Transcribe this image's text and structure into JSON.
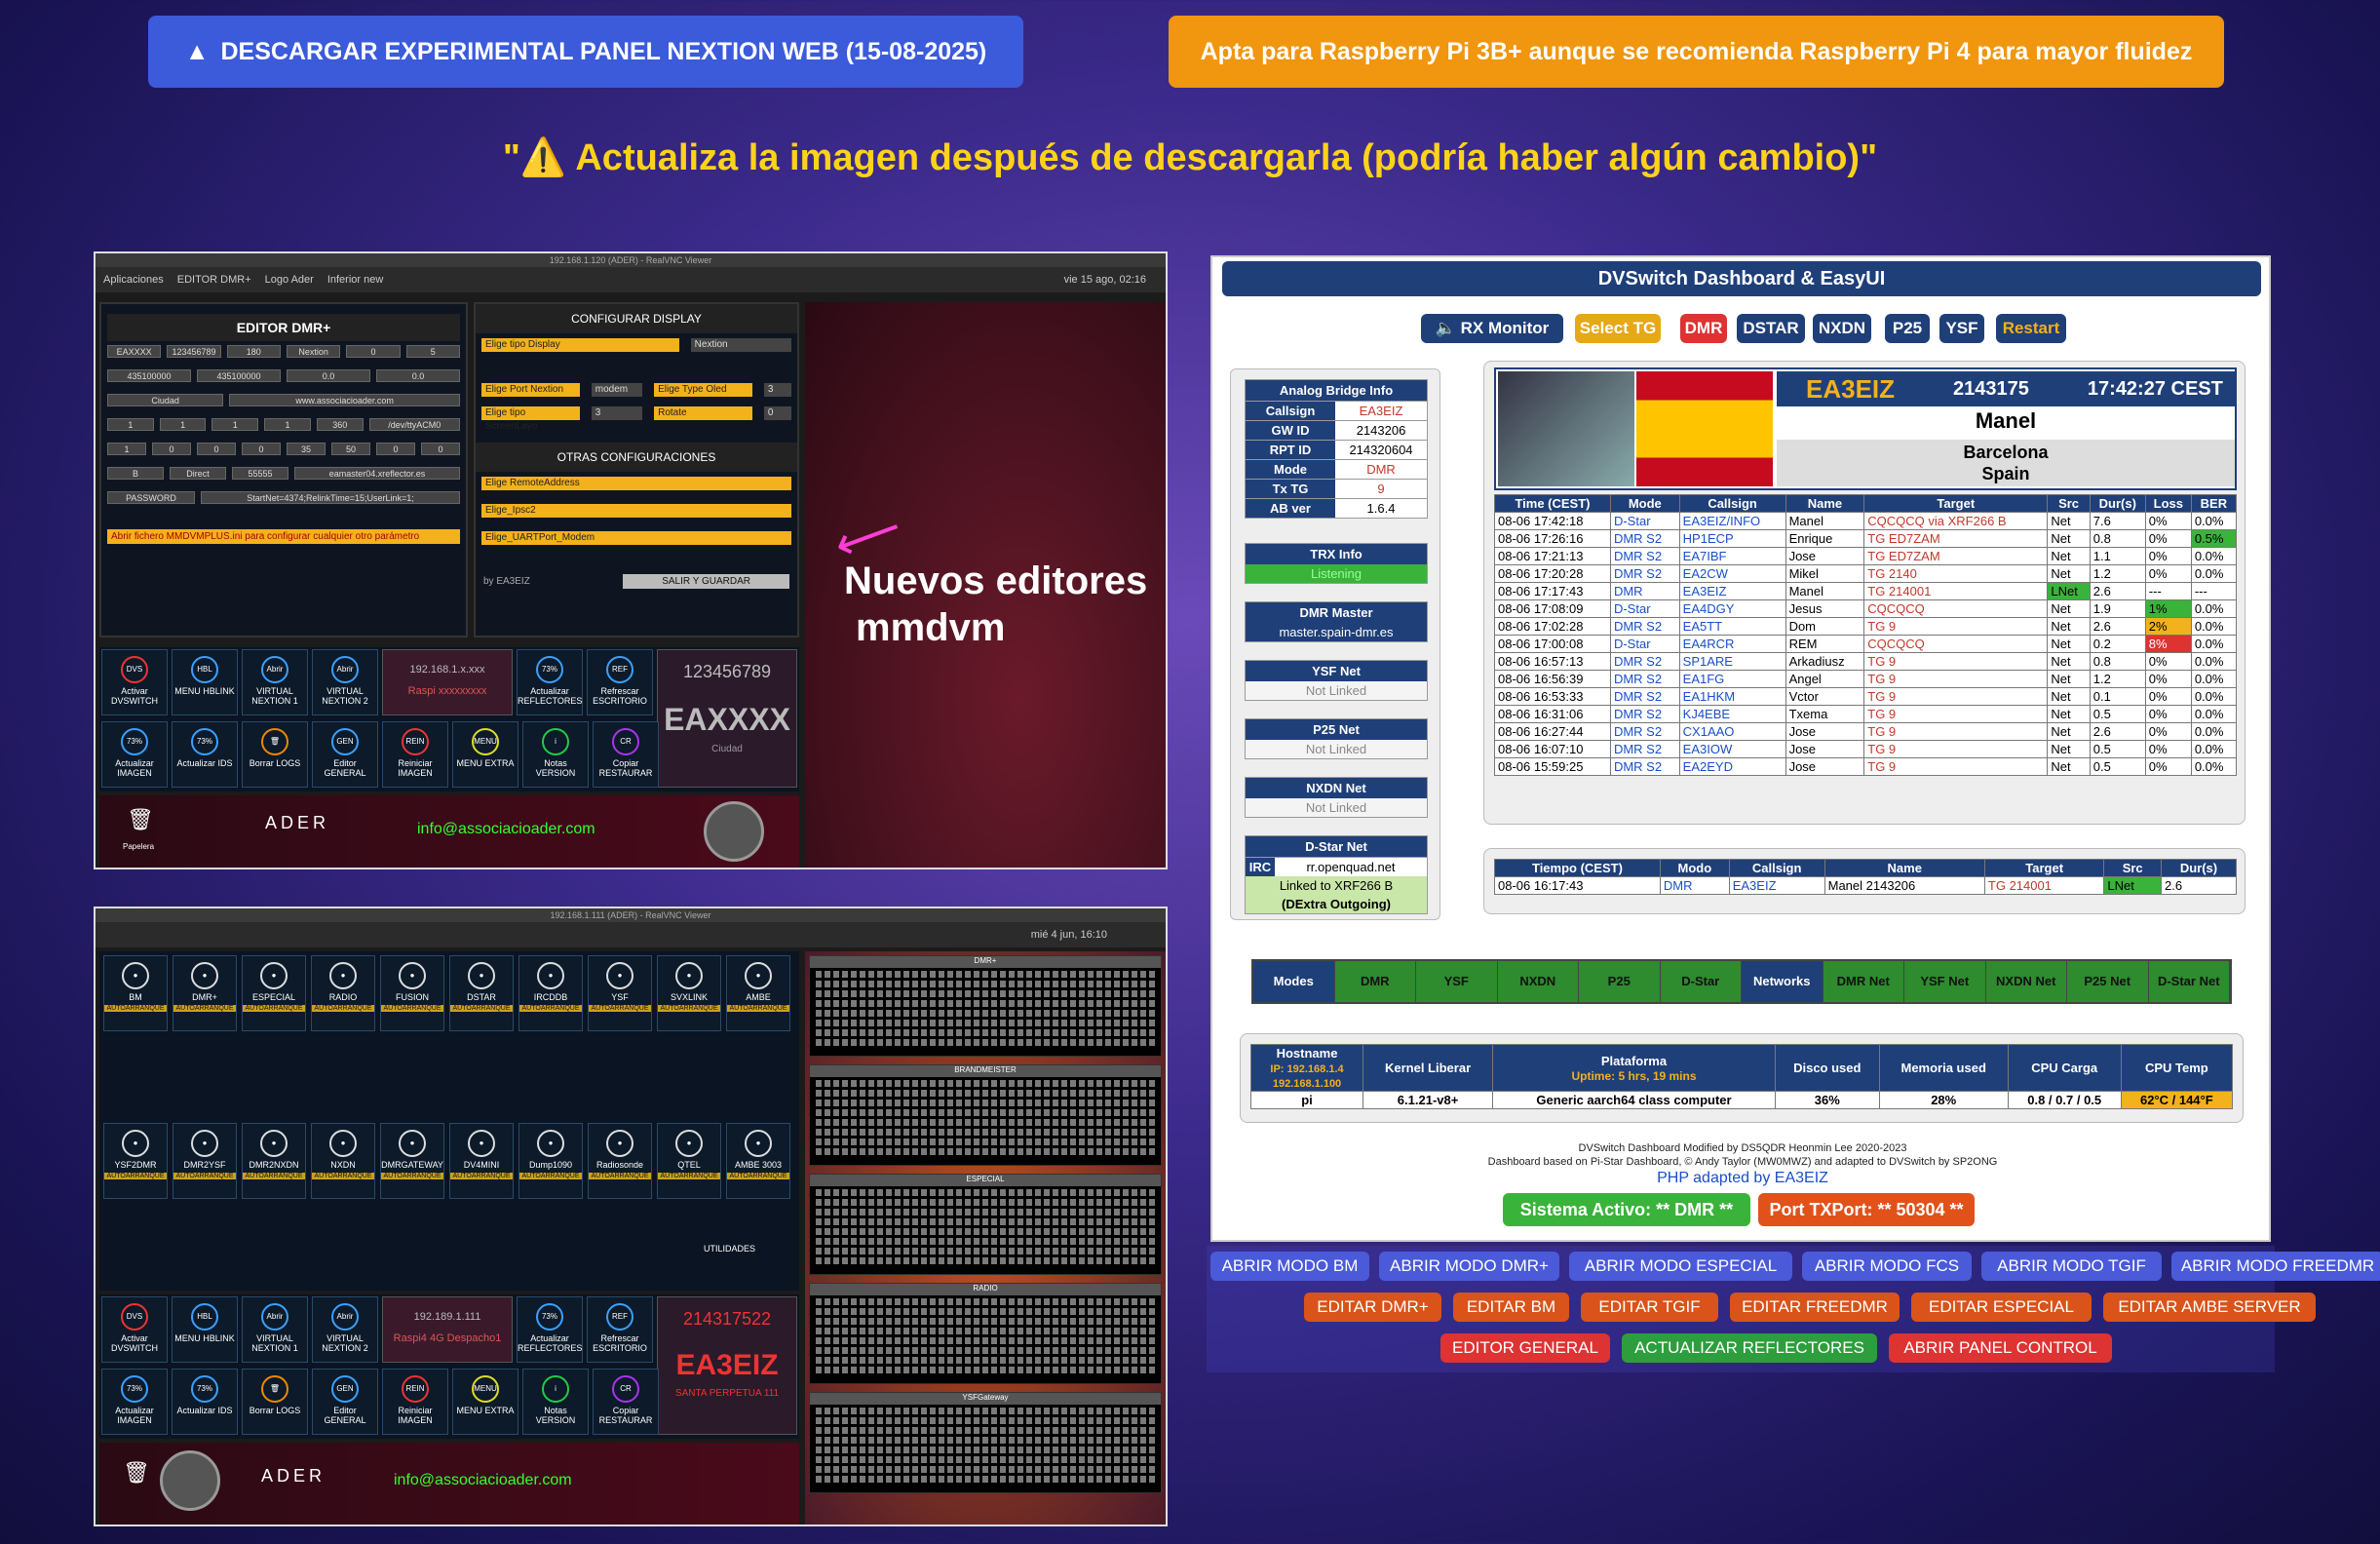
{
  "header": {
    "download_label": "DESCARGAR EXPERIMENTAL PANEL NEXTION WEB (15-08-2025)",
    "apta_text": "Apta para Raspberry Pi 3B+ aunque se recomienda Raspberry Pi 4 para mayor fluidez",
    "warning": "\"⚠️ Actualiza la imagen después de descargarla (podría haber algún cambio)\""
  },
  "editor": {
    "vnc_title": "192.168.1.120 (ADER) - RealVNC Viewer",
    "taskbar": [
      "Aplicaciones",
      "EDITOR DMR+",
      "Logo Ader",
      "Inferior new"
    ],
    "clock": "vie 15 ago, 02:16",
    "title": "EDITOR DMR+",
    "fields": [
      "EAXXXX",
      "123456789",
      "180",
      "Nextion",
      "0",
      "5",
      "435100000",
      "435100000",
      "0.0",
      "0.0",
      "Ciudad",
      "www.associacioader.com",
      "1",
      "1",
      "1",
      "1",
      "360",
      "/dev/ttyACM0",
      "1",
      "0",
      "0",
      "0",
      "35",
      "50",
      "0",
      "0",
      "B",
      "Direct",
      "55555",
      "eamaster04.xreflector.es",
      "PASSWORD",
      "StartNet=4374;RelinkTime=15;UserLink=1;"
    ],
    "mmdvm_notice": "Abrir fichero MMDVMPLUS.ini para configurar cualquier otro parámetro",
    "config_display": "CONFIGURAR DISPLAY",
    "selects": [
      "Elige tipo Display",
      "Nextion",
      "Elige Port Nextion",
      "modem",
      "Elige Type Oled",
      "3",
      "Elige tipo ScreenLayo",
      "3",
      "Rotate",
      "0"
    ],
    "otras": "OTRAS CONFIGURACIONES",
    "selects2": [
      "Elige RemoteAddress",
      "Elige_Ipsc2",
      "Elige_UARTPort_Modem"
    ],
    "by": "by EA3EIZ",
    "salir": "SALIR Y GUARDAR",
    "ip": "192.168.1.x.xxx",
    "raspi": "Raspi xxxxxxxxx",
    "id": "123456789",
    "call": "EAXXXX",
    "ciudad": "Ciudad",
    "email": "info@associacioader.com",
    "papelera": "Papelera",
    "ader": "ADER"
  },
  "nuevos": [
    "Nuevos editores",
    "mmdvm"
  ],
  "panel2": {
    "vnc_title": "192.168.1.111 (ADER) - RealVNC Viewer",
    "clock": "mié 4 jun, 16:10",
    "ip": "192.189.1.111",
    "raspi": "Raspi4 4G Despacho1",
    "id": "214317522",
    "call": "EA3EIZ",
    "city": "SANTA PERPETUA 111",
    "email": "info@associacioader.com",
    "utilidades": "UTILIDADES",
    "row1": [
      "BM",
      "DMR+",
      "ESPECIAL",
      "RADIO",
      "FUSION",
      "DSTAR",
      "IRCDDB",
      "YSF",
      "SVXLINK",
      "AMBE"
    ],
    "row3": [
      "YSF2DMR",
      "DMR2YSF",
      "DMR2NXDN",
      "NXDN",
      "DMRGATEWAY",
      "DV4MINI",
      "Dump1090",
      "Radiosonde",
      "QTEL",
      "AMBE 3003"
    ],
    "autoarranque": "AUTOARRANQUE",
    "term_titles": [
      "DMR+",
      "BRANDMEISTER",
      "ESPECIAL",
      "RADIO",
      "YSFGateway"
    ]
  },
  "buttons": {
    "row_top": [
      "Activar DVSWITCH",
      "MENU HBLINK",
      "VIRTUAL NEXTION 1",
      "VIRTUAL NEXTION 2",
      "Actualizar REFLECTORES",
      "Refrescar ESCRITORIO"
    ],
    "row_bot": [
      "Actualizar IMAGEN",
      "Actualizar IDS",
      "Borrar LOGS",
      "Editor GENERAL",
      "Reiniciar IMAGEN",
      "MENU EXTRA",
      "Notas VERSION",
      "Copiar RESTAURAR"
    ]
  },
  "dash": {
    "title": "DVSwitch Dashboard & EasyUI",
    "top_buttons": [
      "🔈 RX Monitor",
      "Select TG",
      "DMR",
      "DSTAR",
      "NXDN",
      "P25",
      "YSF",
      "Restart"
    ],
    "analog": {
      "title": "Analog Bridge Info",
      "rows": [
        [
          "Callsign",
          "EA3EIZ"
        ],
        [
          "GW ID",
          "2143206"
        ],
        [
          "RPT ID",
          "214320604"
        ],
        [
          "Mode",
          "DMR"
        ],
        [
          "Tx TG",
          "9"
        ],
        [
          "AB ver",
          "1.6.4"
        ]
      ]
    },
    "trx": {
      "title": "TRX Info",
      "status": "Listening"
    },
    "dmr_master": {
      "title": "DMR Master",
      "value": "master.spain-dmr.es"
    },
    "ysf": {
      "title": "YSF Net",
      "value": "Not Linked"
    },
    "p25": {
      "title": "P25 Net",
      "value": "Not Linked"
    },
    "nxdn": {
      "title": "NXDN Net",
      "value": "Not Linked"
    },
    "dstar": {
      "title": "D-Star Net",
      "irc": "IRC",
      "irc_val": "rr.openquad.net",
      "linked": "Linked to XRF266 B",
      "out": "(DExtra Outgoing)"
    },
    "card": {
      "call": "EA3EIZ",
      "id": "2143175",
      "time": "17:42:27 CEST",
      "name": "Manel",
      "city": "Barcelona",
      "country": "Spain"
    },
    "headers": [
      "Time (CEST)",
      "Mode",
      "Callsign",
      "Name",
      "Target",
      "Src",
      "Dur(s)",
      "Loss",
      "BER"
    ],
    "rows": [
      [
        "08-06 17:42:18",
        "D-Star",
        "EA3EIZ/INFO",
        "Manel",
        "CQCQCQ via XRF266 B",
        "Net",
        "7.6",
        "0%",
        "0.0%"
      ],
      [
        "08-06 17:26:16",
        "DMR S2",
        "HP1ECP",
        "Enrique",
        "TG ED7ZAM",
        "Net",
        "0.8",
        "0%",
        "0.5%"
      ],
      [
        "08-06 17:21:13",
        "DMR S2",
        "EA7IBF",
        "Jose",
        "TG ED7ZAM",
        "Net",
        "1.1",
        "0%",
        "0.0%"
      ],
      [
        "08-06 17:20:28",
        "DMR S2",
        "EA2CW",
        "Mikel",
        "TG 2140",
        "Net",
        "1.2",
        "0%",
        "0.0%"
      ],
      [
        "08-06 17:17:43",
        "DMR",
        "EA3EIZ",
        "Manel",
        "TG 214001",
        "LNet",
        "2.6",
        "---",
        "---"
      ],
      [
        "08-06 17:08:09",
        "D-Star",
        "EA4DGY",
        "Jesus",
        "CQCQCQ",
        "Net",
        "1.9",
        "1%",
        "0.0%"
      ],
      [
        "08-06 17:02:28",
        "DMR S2",
        "EA5TT",
        "Dom",
        "TG 9",
        "Net",
        "2.6",
        "2%",
        "0.0%"
      ],
      [
        "08-06 17:00:08",
        "D-Star",
        "EA4RCR",
        "REM",
        "CQCQCQ",
        "Net",
        "0.2",
        "8%",
        "0.0%"
      ],
      [
        "08-06 16:57:13",
        "DMR S2",
        "SP1ARE",
        "Arkadiusz",
        "TG 9",
        "Net",
        "0.8",
        "0%",
        "0.0%"
      ],
      [
        "08-06 16:56:39",
        "DMR S2",
        "EA1FG",
        "Angel",
        "TG 9",
        "Net",
        "1.2",
        "0%",
        "0.0%"
      ],
      [
        "08-06 16:53:33",
        "DMR S2",
        "EA1HKM",
        "Vctor",
        "TG 9",
        "Net",
        "0.1",
        "0%",
        "0.0%"
      ],
      [
        "08-06 16:31:06",
        "DMR S2",
        "KJ4EBE",
        "Txema",
        "TG 9",
        "Net",
        "0.5",
        "0%",
        "0.0%"
      ],
      [
        "08-06 16:27:44",
        "DMR S2",
        "CX1AAO",
        "Jose",
        "TG 9",
        "Net",
        "2.6",
        "0%",
        "0.0%"
      ],
      [
        "08-06 16:07:10",
        "DMR S2",
        "EA3IOW",
        "Jose",
        "TG 9",
        "Net",
        "0.5",
        "0%",
        "0.0%"
      ],
      [
        "08-06 15:59:25",
        "DMR S2",
        "EA2EYD",
        "Jose",
        "TG 9",
        "Net",
        "0.5",
        "0%",
        "0.0%"
      ]
    ],
    "local_headers": [
      "Tiempo (CEST)",
      "Modo",
      "Callsign",
      "Name",
      "Target",
      "Src",
      "Dur(s)"
    ],
    "local_row": [
      "08-06 16:17:43",
      "DMR",
      "EA3EIZ",
      "Manel 2143206",
      "TG 214001",
      "LNet",
      "2.6"
    ],
    "modes": [
      "Modes",
      "DMR",
      "YSF",
      "NXDN",
      "P25",
      "D-Star",
      "Networks",
      "DMR Net",
      "YSF Net",
      "NXDN Net",
      "P25 Net",
      "D-Star Net"
    ],
    "sys_headers": [
      "Hostname",
      "Kernel Liberar",
      "Plataforma",
      "Disco used",
      "Memoria used",
      "CPU Carga",
      "CPU Temp"
    ],
    "ip_line": "IP: 192.168.1.4",
    "ip_line2": "192.168.1.100",
    "uptime": "Uptime: 5 hrs, 19 mins",
    "sys_vals": [
      "pi",
      "6.1.21-v8+",
      "Generic aarch64 class computer",
      "36%",
      "28%",
      "0.8 / 0.7 / 0.5",
      "62°C / 144°F"
    ],
    "foot1": "DVSwitch Dashboard Modified by DS5QDR Heonmin Lee 2020-2023",
    "foot2": "Dashboard based on Pi-Star Dashboard, © Andy Taylor (MW0MWZ) and adapted to DVSwitch by SP2ONG",
    "foot3": "PHP adapted by EA3EIZ",
    "sistema": "Sistema Activo:    ** DMR **",
    "port": "Port TXPort:    ** 50304 **"
  },
  "actions": {
    "row1": [
      "ABRIR MODO BM",
      "ABRIR MODO DMR+",
      "ABRIR MODO ESPECIAL",
      "ABRIR MODO FCS",
      "ABRIR MODO TGIF",
      "ABRIR MODO FREEDMR"
    ],
    "row2": [
      "EDITAR DMR+",
      "EDITAR BM",
      "EDITAR TGIF",
      "EDITAR FREEDMR",
      "EDITAR ESPECIAL",
      "EDITAR AMBE SERVER"
    ],
    "row3": [
      "EDITOR GENERAL",
      "ACTUALIZAR REFLECTORES",
      "ABRIR PANEL CONTROL"
    ]
  }
}
